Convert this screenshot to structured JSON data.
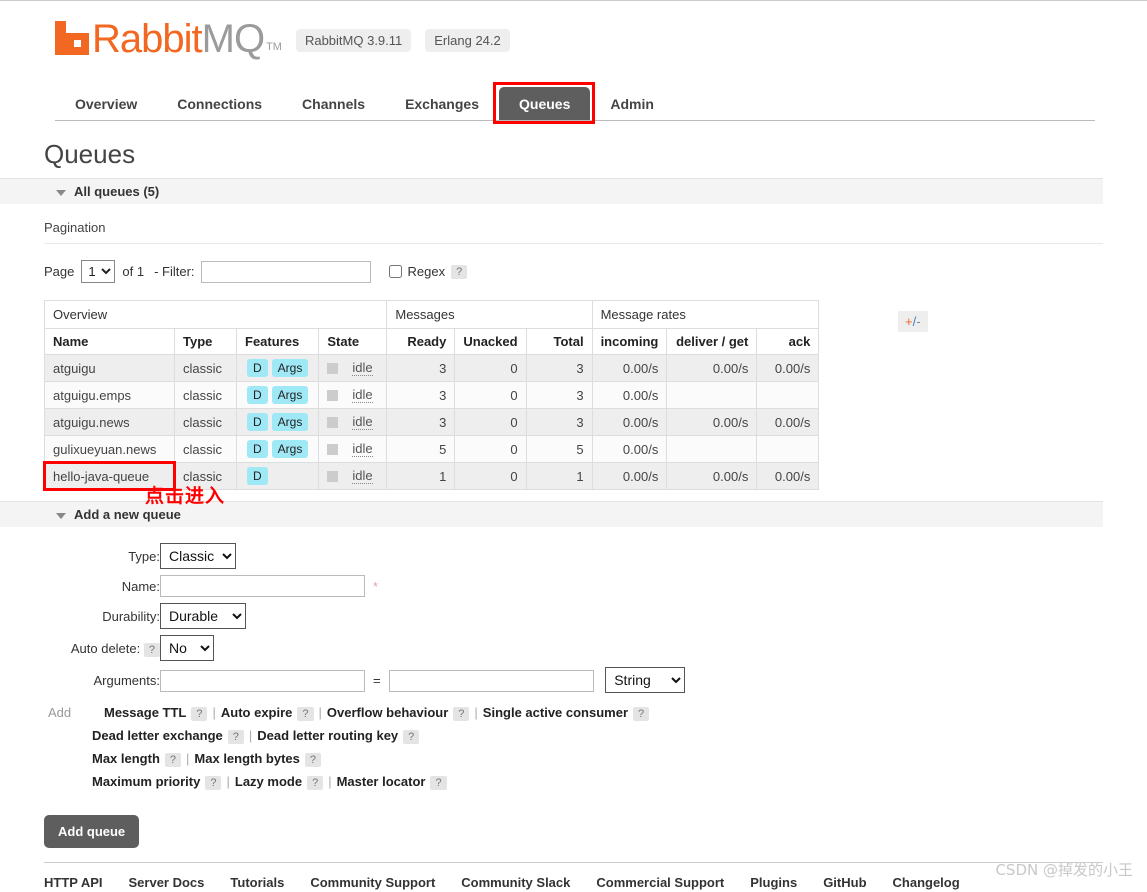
{
  "header": {
    "logo_rabbit": "Rabbit",
    "logo_mq": "MQ",
    "trademark": "TM",
    "version_badge": "RabbitMQ 3.9.11",
    "erlang_badge": "Erlang 24.2"
  },
  "tabs": [
    {
      "label": "Overview",
      "active": false
    },
    {
      "label": "Connections",
      "active": false
    },
    {
      "label": "Channels",
      "active": false
    },
    {
      "label": "Exchanges",
      "active": false
    },
    {
      "label": "Queues",
      "active": true
    },
    {
      "label": "Admin",
      "active": false
    }
  ],
  "page": {
    "title": "Queues",
    "all_queues_header": "All queues (5)",
    "pagination_label": "Pagination"
  },
  "pagination": {
    "page_label": "Page",
    "page_value": "1",
    "of_label": "of 1",
    "filter_label": "- Filter:",
    "filter_value": "",
    "regex_label": "Regex",
    "regex_help": "?",
    "regex_checked": false
  },
  "table": {
    "group_overview": "Overview",
    "group_messages": "Messages",
    "group_rates": "Message rates",
    "plus_minus": "+/-",
    "columns": {
      "name": "Name",
      "type": "Type",
      "features": "Features",
      "state": "State",
      "ready": "Ready",
      "unacked": "Unacked",
      "total": "Total",
      "incoming": "incoming",
      "deliver_get": "deliver / get",
      "ack": "ack"
    },
    "rows": [
      {
        "name": "atguigu",
        "type": "classic",
        "features": [
          "D",
          "Args"
        ],
        "state": "idle",
        "ready": "3",
        "unacked": "0",
        "total": "3",
        "incoming": "0.00/s",
        "deliver_get": "0.00/s",
        "ack": "0.00/s",
        "highlighted": false
      },
      {
        "name": "atguigu.emps",
        "type": "classic",
        "features": [
          "D",
          "Args"
        ],
        "state": "idle",
        "ready": "3",
        "unacked": "0",
        "total": "3",
        "incoming": "0.00/s",
        "deliver_get": "",
        "ack": "",
        "highlighted": false
      },
      {
        "name": "atguigu.news",
        "type": "classic",
        "features": [
          "D",
          "Args"
        ],
        "state": "idle",
        "ready": "3",
        "unacked": "0",
        "total": "3",
        "incoming": "0.00/s",
        "deliver_get": "0.00/s",
        "ack": "0.00/s",
        "highlighted": false
      },
      {
        "name": "gulixueyuan.news",
        "type": "classic",
        "features": [
          "D",
          "Args"
        ],
        "state": "idle",
        "ready": "5",
        "unacked": "0",
        "total": "5",
        "incoming": "0.00/s",
        "deliver_get": "",
        "ack": "",
        "highlighted": false
      },
      {
        "name": "hello-java-queue",
        "type": "classic",
        "features": [
          "D"
        ],
        "state": "idle",
        "ready": "1",
        "unacked": "0",
        "total": "1",
        "incoming": "0.00/s",
        "deliver_get": "0.00/s",
        "ack": "0.00/s",
        "highlighted": true
      }
    ]
  },
  "annotation": {
    "text": "点击进入",
    "color": "#fe0000"
  },
  "add_queue": {
    "section_header": "Add a new queue",
    "type_label": "Type:",
    "type_value": "Classic",
    "name_label": "Name:",
    "name_value": "",
    "name_required": "*",
    "durability_label": "Durability:",
    "durability_value": "Durable",
    "auto_delete_label": "Auto delete:",
    "auto_delete_help": "?",
    "auto_delete_value": "No",
    "arguments_label": "Arguments:",
    "arg_key_value": "",
    "arg_val_value": "",
    "arg_type_value": "String",
    "equals": "=",
    "add_label": "Add",
    "preset_rows": [
      [
        "Message TTL",
        "Auto expire",
        "Overflow behaviour",
        "Single active consumer"
      ],
      [
        "Dead letter exchange",
        "Dead letter routing key"
      ],
      [
        "Max length",
        "Max length bytes"
      ],
      [
        "Maximum priority",
        "Lazy mode",
        "Master locator"
      ]
    ],
    "submit_label": "Add queue"
  },
  "footer": {
    "links": [
      "HTTP API",
      "Server Docs",
      "Tutorials",
      "Community Support",
      "Community Slack",
      "Commercial Support",
      "Plugins",
      "GitHub",
      "Changelog"
    ]
  },
  "watermark": "CSDN @掉发的小王",
  "colors": {
    "brand_orange": "#f26822",
    "active_tab": "#5e5e5e",
    "badge_cyan": "#9fe8f5",
    "annotation_red": "#fe0000"
  }
}
